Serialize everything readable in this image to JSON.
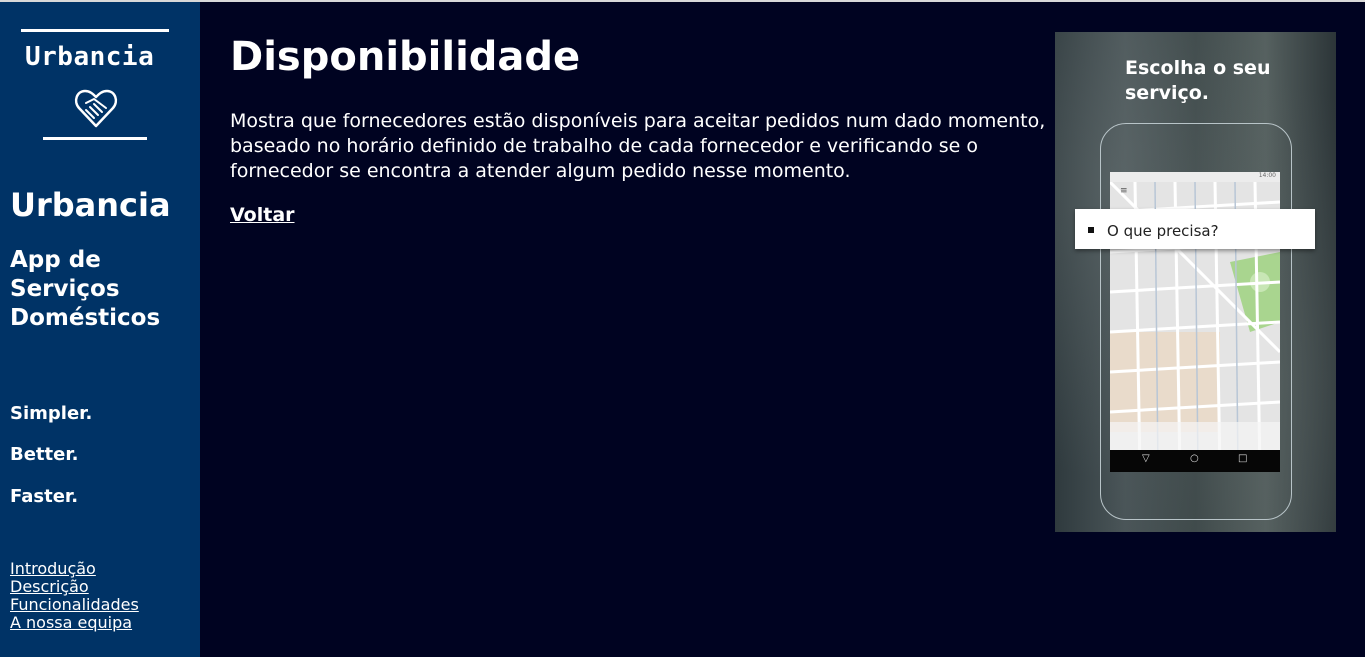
{
  "sidebar": {
    "logo_text": "Urbancia",
    "brand": "Urbancia",
    "tagline": "App de Serviços Domésticos",
    "motto": [
      "Simpler.",
      "Better.",
      "Faster."
    ],
    "nav": [
      "Introdução",
      "Descrição",
      "Funcionalidades",
      "A nossa equipa"
    ]
  },
  "main": {
    "title": "Disponibilidade",
    "description": "Mostra que fornecedores estão disponíveis para aceitar pedidos num dado momento, baseado no horário definido de trabalho de cada fornecedor e verificando se o fornecedor se encontra a atender algum pedido nesse momento.",
    "back_link": "Voltar"
  },
  "promo": {
    "title": "Escolha o seu serviço.",
    "status_time": "14:00",
    "search_placeholder": "O que precisa?"
  },
  "colors": {
    "background": "#000321",
    "sidebar": "#003366",
    "text": "#ffffff"
  },
  "icons": [
    "handshake-heart-icon",
    "menu-icon",
    "back-triangle-icon",
    "home-circle-icon",
    "recent-square-icon"
  ]
}
